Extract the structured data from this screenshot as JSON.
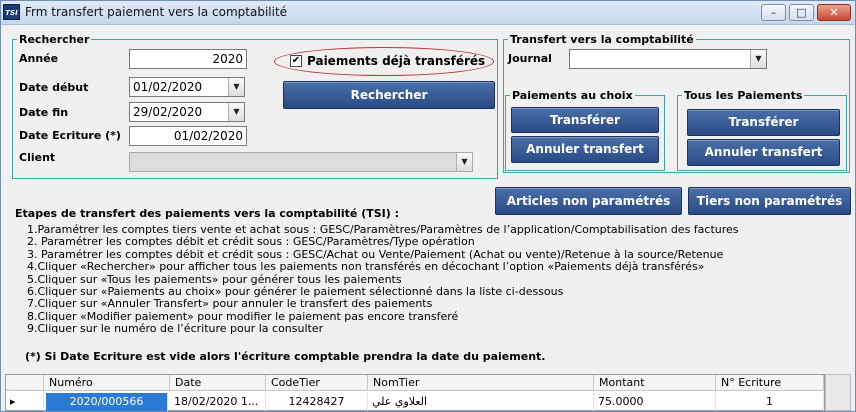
{
  "window": {
    "title": "Frm transfert paiement vers la comptabilité",
    "icon": "TSI"
  },
  "titlebar_buttons": {
    "minimize": "–",
    "maximize": "□",
    "close": "✕"
  },
  "search": {
    "legend": "Rechercher",
    "annee_label": "Année",
    "annee_value": "2020",
    "date_debut_label": "Date début",
    "date_debut_value": "01/02/2020",
    "date_fin_label": "Date fin",
    "date_fin_value": "29/02/2020",
    "date_ecriture_label": "Date Ecriture (*)",
    "date_ecriture_value": "01/02/2020",
    "client_label": "Client",
    "client_value": "",
    "deja_transferes_label": "Paiements déjà transférés",
    "deja_transferes_checked": true,
    "rechercher_button": "Rechercher"
  },
  "transfer": {
    "legend": "Transfert vers la comptabilité",
    "journal_label": "Journal",
    "journal_value": "",
    "au_choix": {
      "legend": "Paiements au choix",
      "transferer": "Transférer",
      "annuler": "Annuler transfert"
    },
    "tous": {
      "legend": "Tous les Paiements",
      "transferer": "Transférer",
      "annuler": "Annuler transfert"
    }
  },
  "buttons": {
    "articles": "Articles non paramétrés",
    "tiers": "Tiers non paramétrés"
  },
  "steps": {
    "title": "Etapes de transfert des paiements vers la comptabilité (TSI) :",
    "items": [
      "1.Paramétrer les comptes tiers vente et achat  sous : GESC/Paramètres/Paramètres de l’application/Comptabilisation des factures",
      "2. Paramétrer les comptes débit et crédit sous : GESC/Paramètres/Type opération",
      "3. Paramétrer les comptes débit et crédit sous : GESC/Achat ou Vente/Paiement (Achat ou vente)/Retenue à la source/Retenue",
      "4.Cliquer «Rechercher» pour afficher tous les paiements non transférés en décochant l’option «Paiements déjà transférés»",
      "5.Cliquer sur «Tous les paiements» pour générer tous les paiements",
      "6.Cliquer sur «Paiements au choix» pour générer le paiement sélectionné dans la liste ci-dessous",
      "7.Cliquer sur «Annuler Transfert» pour annuler le transfert des paiements",
      "8.Cliquer «Modifier paiement» pour modifier le paiement pas encore transferé",
      "9.Cliquer sur le numéro de l’écriture pour la consulter"
    ],
    "note": "(*) Si Date Ecriture est vide alors l'écriture comptable prendra la date du paiement."
  },
  "grid": {
    "columns": [
      "Numéro",
      "Date",
      "CodeTier",
      "NomTier",
      "Montant",
      "N° Ecriture"
    ],
    "row_indicator": "▸",
    "row": [
      "2020/000566",
      "18/02/2020 1...",
      "12428427",
      "العلاوي علي",
      "75.0000",
      "1"
    ]
  },
  "colors": {
    "button": "#2f5490",
    "fieldset_border": "#3fa6ad",
    "highlight_ellipse": "#c2312d",
    "selected_cell": "#2b7ad6"
  }
}
